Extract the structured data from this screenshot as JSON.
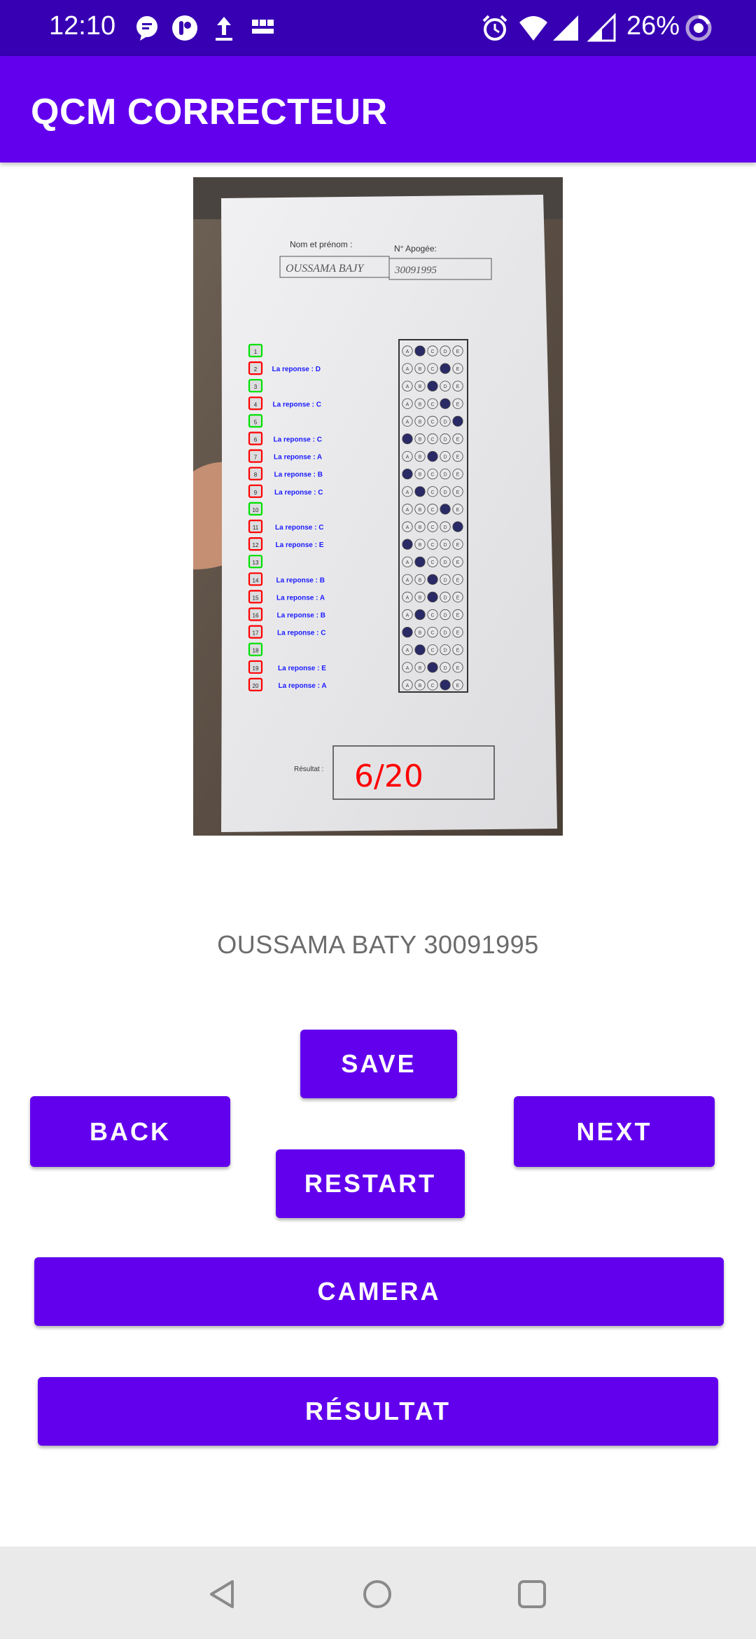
{
  "status_bar": {
    "time": "12:10",
    "battery": "26%",
    "icons": [
      "message-icon",
      "notification-icon",
      "upload-icon",
      "bbc-news-icon",
      "alarm-icon",
      "wifi-icon",
      "signal-icon",
      "signal-icon",
      "battery-saver-icon"
    ],
    "bbc_label": "BBC NEWS"
  },
  "app_bar": {
    "title": "QCM CORRECTEUR"
  },
  "sheet": {
    "name_label": "Nom et prénom :",
    "apogee_label": "N° Apogée:",
    "name_value": "OUSSAMA BAJY",
    "apogee_value": "30091995",
    "result_label": "Résultat :",
    "score": "6/20",
    "questions": [
      {
        "n": "1",
        "status": "correct",
        "answer": ""
      },
      {
        "n": "2",
        "status": "wrong",
        "answer": "La reponse : D"
      },
      {
        "n": "3",
        "status": "correct",
        "answer": ""
      },
      {
        "n": "4",
        "status": "wrong",
        "answer": "La reponse : C"
      },
      {
        "n": "5",
        "status": "correct",
        "answer": ""
      },
      {
        "n": "6",
        "status": "wrong",
        "answer": "La reponse : C"
      },
      {
        "n": "7",
        "status": "wrong",
        "answer": "La reponse : A"
      },
      {
        "n": "8",
        "status": "wrong",
        "answer": "La reponse : B"
      },
      {
        "n": "9",
        "status": "wrong",
        "answer": "La reponse : C"
      },
      {
        "n": "10",
        "status": "correct",
        "answer": ""
      },
      {
        "n": "11",
        "status": "wrong",
        "answer": "La reponse : C"
      },
      {
        "n": "12",
        "status": "wrong",
        "answer": "La reponse : E"
      },
      {
        "n": "13",
        "status": "correct",
        "answer": ""
      },
      {
        "n": "14",
        "status": "wrong",
        "answer": "La reponse : B"
      },
      {
        "n": "15",
        "status": "wrong",
        "answer": "La reponse : A"
      },
      {
        "n": "16",
        "status": "wrong",
        "answer": "La reponse : B"
      },
      {
        "n": "17",
        "status": "wrong",
        "answer": "La reponse : C"
      },
      {
        "n": "18",
        "status": "correct",
        "answer": ""
      },
      {
        "n": "19",
        "status": "wrong",
        "answer": "La reponse : E"
      },
      {
        "n": "20",
        "status": "wrong",
        "answer": "La reponse : A"
      }
    ],
    "choices": [
      "A",
      "B",
      "C",
      "D",
      "E"
    ],
    "marked": [
      1,
      3,
      2,
      3,
      4,
      0,
      2,
      0,
      1,
      3,
      4,
      0,
      1,
      2,
      2,
      1,
      0,
      1,
      2,
      3
    ]
  },
  "student_info": "OUSSAMA BATY 30091995",
  "buttons": {
    "save": "SAVE",
    "back": "BACK",
    "next": "NEXT",
    "restart": "RESTART",
    "camera": "CAMERA",
    "resultat": "RÉSULTAT"
  },
  "colors": {
    "status_bar": "#3700b3",
    "primary": "#6200ee",
    "correct": "#00e000",
    "wrong": "#ff0000",
    "answer_text": "#1a1aff"
  }
}
